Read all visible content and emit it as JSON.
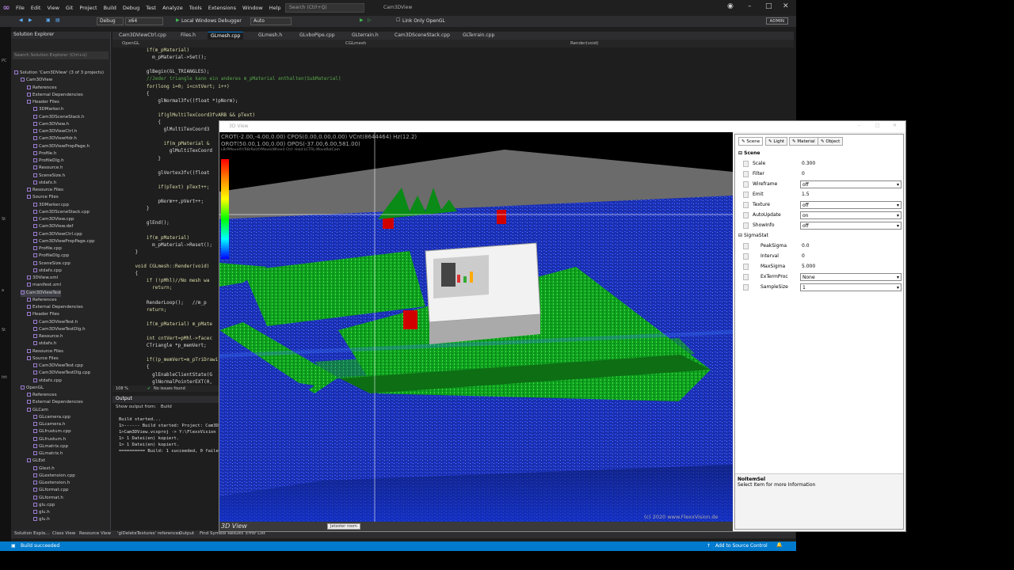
{
  "menu": {
    "items": [
      "File",
      "Edit",
      "View",
      "Git",
      "Project",
      "Build",
      "Debug",
      "Test",
      "Analyze",
      "Tools",
      "Extensions",
      "Window",
      "Help"
    ],
    "search_placeholder": "Search (Ctrl+Q)",
    "project_title": "Cam3DView"
  },
  "toolbar": {
    "config": "Debug",
    "platform": "x64",
    "debugger": "Local Windows Debugger",
    "mode": "Auto",
    "link_label": "Link Only OpenGL",
    "admin": "ADMIN"
  },
  "left_edge": [
    "PC",
    "St",
    "a",
    "St",
    "htt"
  ],
  "solution_explorer": {
    "title": "Solution Explorer",
    "search_placeholder": "Search Solution Explorer (Ctrl+ü)",
    "items": [
      "Solution 'Cam3DView' (3 of 3 projects)",
      "Cam3DView",
      "References",
      "External Dependencies",
      "Header Files",
      "3DMarker.h",
      "Cam3DSceneStack.h",
      "Cam3DView.h",
      "Cam3DViewCtrl.h",
      "Cam3DViewHdr.h",
      "Cam3DViewPropPage.h",
      "Profile.h",
      "ProfileDlg.h",
      "Resource.h",
      "SceneSize.h",
      "stdafx.h",
      "Resource Files",
      "Source Files",
      "3DMarker.cpp",
      "Cam3DSceneStack.cpp",
      "Cam3DView.cpp",
      "Cam3DView.def",
      "Cam3DViewCtrl.cpp",
      "Cam3DViewPropPage.cpp",
      "Profile.cpp",
      "ProfileDlg.cpp",
      "SceneSize.cpp",
      "stdafx.cpp",
      "3DView.xml",
      "manifest.xml",
      "Cam3DViewTest",
      "References",
      "External Dependencies",
      "Header Files",
      "Cam3DViewTest.h",
      "Cam3DViewTestDlg.h",
      "Resource.h",
      "stdafx.h",
      "Resource Files",
      "Source Files",
      "Cam3DViewTest.cpp",
      "Cam3DViewTestDlg.cpp",
      "stdafx.cpp",
      "OpenGL",
      "References",
      "External Dependencies",
      "GLCam",
      "GLcamera.cpp",
      "GLcamera.h",
      "GLfrustum.cpp",
      "GLfrustum.h",
      "GLmatrix.cpp",
      "GLmatrix.h",
      "GLExt",
      "Glext.h",
      "GLextension.cpp",
      "GLextension.h",
      "GLformat.cpp",
      "GLformat.h",
      "glu.cpp",
      "glu.h",
      "glu.h"
    ]
  },
  "tabs": [
    "Cam3DViewCtrl.cpp",
    "Files.h",
    "GLmesh.cpp",
    "GLmesh.h",
    "GLvboPipe.cpp",
    "GLterrain.h",
    "Cam3DSceneStack.cpp",
    "GLTerrain.cpp"
  ],
  "nav": {
    "scope": "OpenGL",
    "class": "CGLmesh",
    "member": "Render(void)"
  },
  "code": [
    "        if(m_pMaterial)",
    "          m_pMaterial->Set();",
    "",
    "        glBegin(GL_TRIANGLES);",
    "        //Jeder triangle kann ein anderes m_pMaterial enthalten(SubMaterial)",
    "        for(long i=0; i<cntVert; i++)",
    "        {",
    "            glNormal3fv((float *)pNorm);",
    "",
    "            if(glMultiTexCoord3fvARB && pText)",
    "            {",
    "              glMultiTexCoord3",
    "",
    "              if(m_pMaterial &",
    "                glMultiTexCoord",
    "            }",
    "",
    "            glVertex3fv((float",
    "",
    "            if(pText) pText++;",
    "",
    "            pNorm++,pVert++;",
    "        }",
    "",
    "        glEnd();",
    "",
    "        if(m_pMaterial)",
    "          m_pMaterial->Reset();",
    "    }",
    "",
    "    void CGLmesh::Render(void)",
    "    {",
    "        if (!pMhl)//No mesh wa",
    "          return;",
    "",
    "        RenderLoop();   //m_p",
    "        return;",
    "",
    "        if(m_pMaterial) m_pMate",
    "",
    "        int cntVert=pMhl->facec",
    "        CTriangle *p_memVert;",
    "",
    "        if((p_memVert=m_pTriDrawi",
    "        {",
    "          glEnableClientState(G",
    "          glNormalPointerEXT(0,"
  ],
  "editor_status": {
    "zoom": "108 %",
    "issues": "No issues found"
  },
  "output": {
    "title": "Output",
    "show_from": "Show output from:",
    "source": "Build",
    "lines": [
      "Build started...",
      "1>------ Build started: Project: Cam3D",
      "1>Cam3DView.vcxproj -> Y:\\FlexxVision",
      "1>        1 Datei(en) kopiert.",
      "1>        1 Datei(en) kopiert.",
      "========== Build: 1 succeeded, 0 faile"
    ]
  },
  "bottom_tabs": [
    "Solution Explo...",
    "Class View",
    "Resource View",
    "'glDeleteTextures' references",
    "Output",
    "Find Symbol Results",
    "Error List"
  ],
  "status": {
    "left": "Build succeeded",
    "right": "Add to Source Control"
  },
  "app": {
    "title": "3D View",
    "overlay": {
      "line1": "CROT(-2.00,-4.00,0.00) CPOS(0.00,0.00,0.00) VCnt(8644464) Hz(12.2)",
      "line2": "OROT(50.00,1.00,0.00) OPOS(-37.00,6.00,581.00)",
      "line3": "LBrPMoveXY/RBrRotXYMove(Wheel) Ctrl: Hold:LCTRL:MoveRotCam"
    },
    "colorbar_colors": [
      "#ff0000",
      "#ff8800",
      "#ffff00",
      "#00ff00",
      "#00ffff",
      "#0000ff"
    ],
    "copyright": "(c) 2020 www.FlexxVision.de",
    "caption": "3D View",
    "caption_button": "Jetzoter room",
    "prop_tabs": [
      "Scene",
      "Light",
      "Material",
      "Object"
    ],
    "scene_group": "Scene",
    "scene_props": [
      {
        "label": "Scale",
        "value": "0.300",
        "combo": false
      },
      {
        "label": "Filter",
        "value": "0",
        "combo": false
      },
      {
        "label": "Wireframe",
        "value": "off",
        "combo": true
      },
      {
        "label": "Emit",
        "value": "1.5",
        "combo": false
      },
      {
        "label": "Texture",
        "value": "off",
        "combo": true
      },
      {
        "label": "AutoUpdate",
        "value": "on",
        "combo": true
      },
      {
        "label": "ShowInfo",
        "value": "off",
        "combo": true
      }
    ],
    "sigma_group": "SigmaStat",
    "sigma_props": [
      {
        "label": "PeakSigma",
        "value": "0.0",
        "combo": false
      },
      {
        "label": "Interval",
        "value": "0",
        "combo": false
      },
      {
        "label": "MaxSigma",
        "value": "5.000",
        "combo": false
      },
      {
        "label": "ExTermProc",
        "value": "None",
        "combo": true
      },
      {
        "label": "SampleSize",
        "value": "1",
        "combo": true
      }
    ],
    "info_title": "NoItemSel",
    "info_text": "Select Item for more Information"
  }
}
